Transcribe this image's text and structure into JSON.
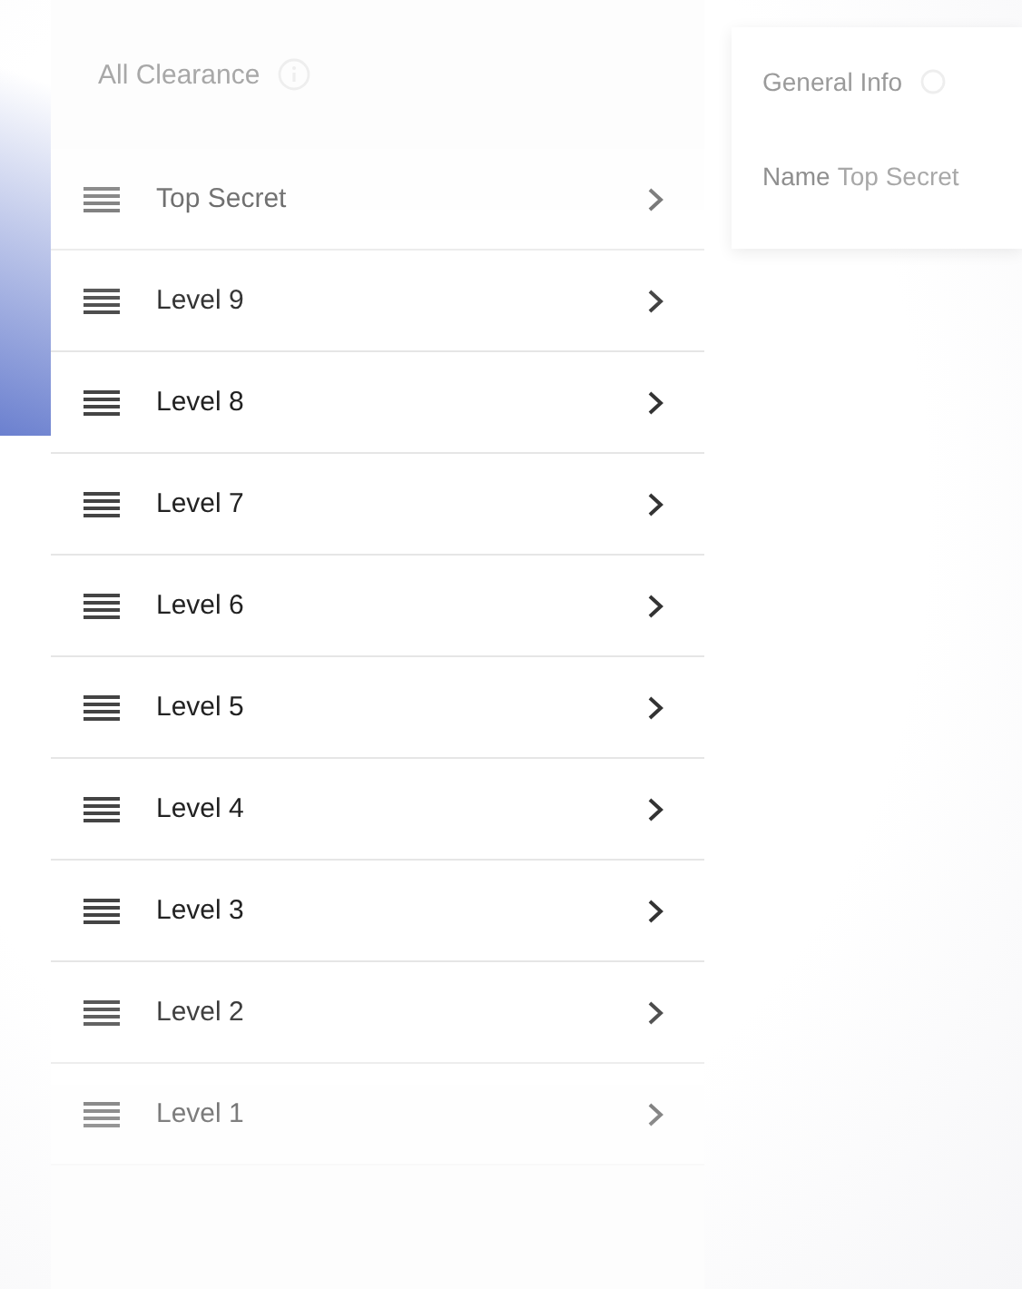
{
  "header": {
    "title": "All Clearance"
  },
  "levels": [
    {
      "label": "Top Secret"
    },
    {
      "label": "Level 9"
    },
    {
      "label": "Level 8"
    },
    {
      "label": "Level 7"
    },
    {
      "label": "Level 6"
    },
    {
      "label": "Level 5"
    },
    {
      "label": "Level 4"
    },
    {
      "label": "Level 3"
    },
    {
      "label": "Level 2"
    },
    {
      "label": "Level 1"
    }
  ],
  "detail": {
    "title": "General Info",
    "field_label": "Name",
    "field_value": "Top Secret"
  }
}
